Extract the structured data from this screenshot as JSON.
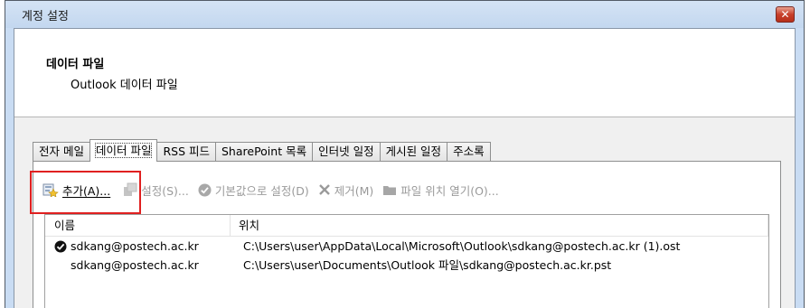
{
  "window": {
    "title": "계정 설정"
  },
  "header": {
    "title": "데이터 파일",
    "subtitle": "Outlook 데이터 파일"
  },
  "tabs": [
    {
      "label": "전자 메일"
    },
    {
      "label": "데이터 파일"
    },
    {
      "label": "RSS 피드"
    },
    {
      "label": "SharePoint 목록"
    },
    {
      "label": "인터넷 일정"
    },
    {
      "label": "게시된 일정"
    },
    {
      "label": "주소록"
    }
  ],
  "toolbar": {
    "add": "추가(A)...",
    "settings": "설정(S)...",
    "set_default": "기본값으로 설정(D)",
    "remove": "제거(M)",
    "open_location": "파일 위치 열기(O)..."
  },
  "list": {
    "columns": {
      "name": "이름",
      "location": "위치"
    },
    "rows": [
      {
        "name": "sdkang@postech.ac.kr",
        "location": "C:\\Users\\user\\AppData\\Local\\Microsoft\\Outlook\\sdkang@postech.ac.kr (1).ost",
        "default": true
      },
      {
        "name": "sdkang@postech.ac.kr",
        "location": "C:\\Users\\user\\Documents\\Outlook 파일\\sdkang@postech.ac.kr.pst",
        "default": false
      }
    ]
  },
  "colors": {
    "highlight": "#e02020",
    "close_button": "#c8402b"
  }
}
